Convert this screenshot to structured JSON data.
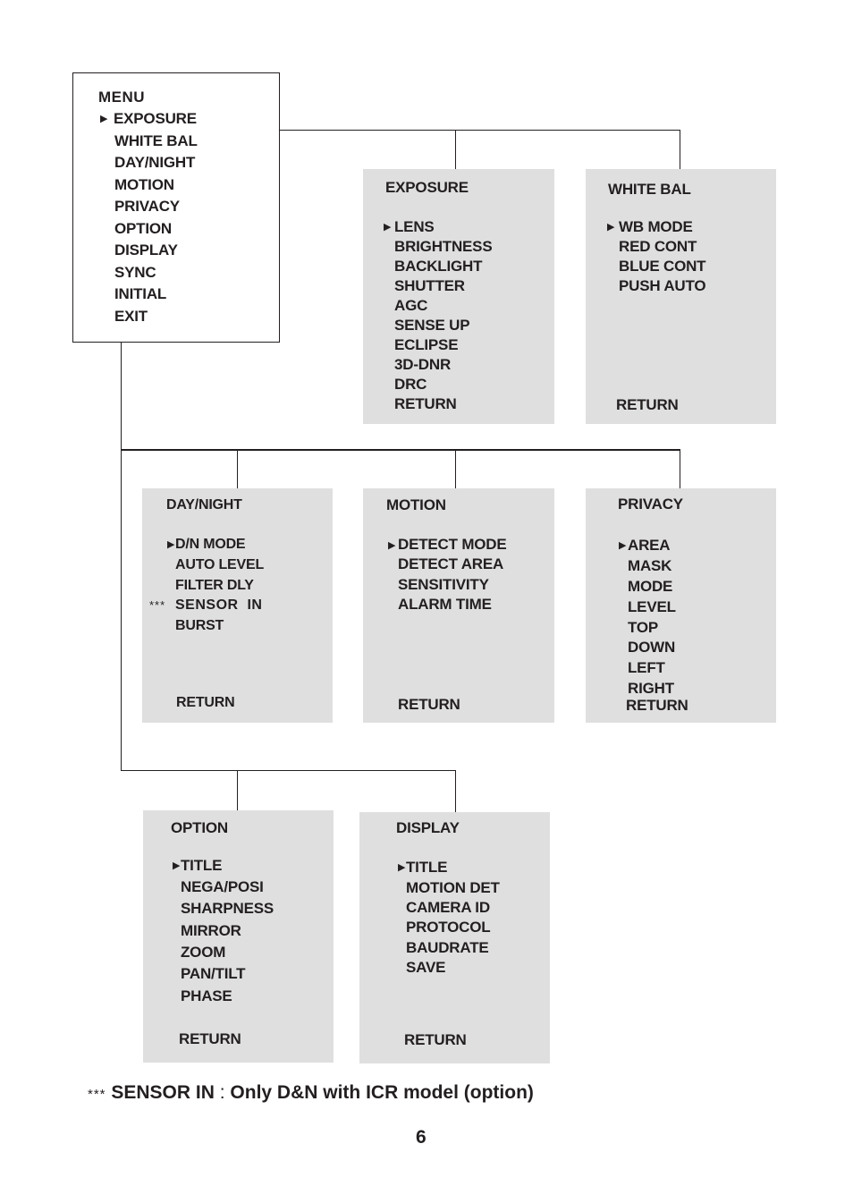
{
  "main_menu": {
    "title": "MENU",
    "items": [
      "EXPOSURE",
      "WHITE BAL",
      "DAY/NIGHT",
      "MOTION",
      "PRIVACY",
      "OPTION",
      "DISPLAY",
      "SYNC",
      "INITIAL",
      "EXIT"
    ],
    "selected_marker": "▶"
  },
  "submenus": {
    "exposure": {
      "title": "EXPOSURE",
      "items": [
        "LENS",
        "BRIGHTNESS",
        "BACKLIGHT",
        "SHUTTER",
        "AGC",
        "SENSE UP",
        "ECLIPSE",
        "3D-DNR",
        "DRC",
        "RETURN"
      ]
    },
    "white_bal": {
      "title": "WHITE BAL",
      "items": [
        "WB MODE",
        "RED CONT",
        "BLUE CONT",
        "PUSH AUTO"
      ],
      "return": "RETURN"
    },
    "day_night": {
      "title": "DAY/NIGHT",
      "items": [
        "D/N MODE",
        "AUTO LEVEL",
        "FILTER DLY",
        "SENSOR  IN",
        "BURST"
      ],
      "sensor_marker": "***",
      "return": "RETURN"
    },
    "motion": {
      "title": "MOTION",
      "items": [
        "DETECT MODE",
        "DETECT AREA",
        "SENSITIVITY",
        "ALARM TIME"
      ],
      "return": "RETURN"
    },
    "privacy": {
      "title": "PRIVACY",
      "items": [
        "AREA",
        "MASK",
        "MODE",
        "LEVEL",
        "TOP",
        "DOWN",
        "LEFT",
        "RIGHT"
      ],
      "return": "RETURN"
    },
    "option": {
      "title": "OPTION",
      "items": [
        "TITLE",
        "NEGA/POSI",
        "SHARPNESS",
        "MIRROR",
        "ZOOM",
        "PAN/TILT",
        "PHASE"
      ],
      "return": "RETURN"
    },
    "display": {
      "title": "DISPLAY",
      "items": [
        "TITLE",
        "MOTION DET",
        "CAMERA ID",
        "PROTOCOL",
        "BAUDRATE",
        "SAVE"
      ],
      "return": "RETURN"
    }
  },
  "footnote": {
    "marker": "***",
    "term": "SENSOR IN",
    "separator": ":",
    "text": "Only D&N with ICR model (option)"
  },
  "page_number": "6"
}
